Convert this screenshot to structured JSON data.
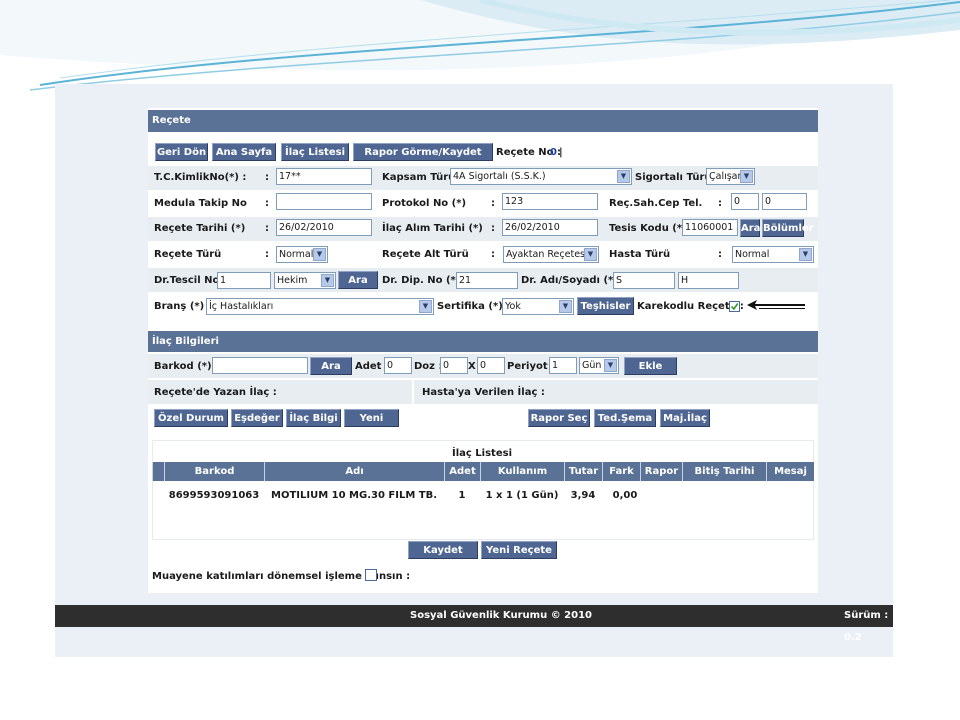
{
  "colors": {
    "header_bar": "#5a7296",
    "button": "#4e6691",
    "footer": "#2e2e2e",
    "row_alt": "#e8edf2",
    "frame": "#eaf0f6"
  },
  "recete": {
    "title": "Reçete",
    "buttons": {
      "geri_don": "Geri Dön",
      "ana_sayfa": "Ana Sayfa",
      "ilac_listesi": "İlaç Listesi",
      "rapor_gorme": "Rapor Görme/Kaydet"
    },
    "recete_no_label": "Reçete No :",
    "recete_no_value": "0",
    "recete_no_sep": "|",
    "tc_label": "T.C.KimlikNo(*) :",
    "tc_value": "17**",
    "kapsam_label": "Kapsam Türü :",
    "kapsam_value": "4A Sigortalı (S.S.K.)",
    "sigortali_label": "Sigortalı Türü :",
    "sigortali_value": "Çalışan",
    "medula_label": "Medula Takip No",
    "medula_value": "",
    "protokol_label": "Protokol No (*)",
    "protokol_value": "123",
    "cep_label": "Reç.Sah.Cep Tel.",
    "cep_value1": "0",
    "cep_value2": "0",
    "tarih_label": "Reçete Tarihi (*)",
    "tarih_value": "26/02/2010",
    "alim_label": "İlaç Alım Tarihi (*)",
    "alim_value": "26/02/2010",
    "tesis_label": "Tesis Kodu (*) :",
    "tesis_value": "11060001",
    "ara": "Ara",
    "bolumler": "Bölümler",
    "turu_label": "Reçete Türü",
    "turu_value": "Normal",
    "alt_label": "Reçete Alt Türü",
    "alt_value": "Ayaktan Reçetesi",
    "hasta_label": "Hasta Türü",
    "hasta_value": "Normal",
    "tescil_label": "Dr.Tescil No :",
    "tescil_value": "1",
    "hekim_value": "Hekim",
    "dip_label": "Dr. Dip. No (*) :",
    "dip_value": "21",
    "adi_label": "Dr. Adı/Soyadı (*) :",
    "adi_value1": "S",
    "adi_value2": "H",
    "brans_label": "Branş (*) :",
    "brans_value": "İç Hastalıkları",
    "sertifika_label": "Sertifika (*) :",
    "sertifika_value": "Yok",
    "teshisler": "Teşhisler",
    "karekod_label": "Karekodlu Reçete :",
    "colon": ":"
  },
  "ilac": {
    "title": "İlaç Bilgileri",
    "barkod_label": "Barkod (*) :",
    "barkod_value": "",
    "ara": "Ara",
    "adet_label": "Adet :",
    "adet_value": "0",
    "doz_label": "Doz :",
    "doz_value1": "0",
    "doz_x": "X",
    "doz_value2": "0",
    "periyot_label": "Periyot :",
    "periyot_value": "1",
    "periyot_unit": "Gün",
    "ekle": "Ekle",
    "yazan_label": "Reçete'de Yazan İlaç :",
    "verilen_label": "Hasta'ya Verilen İlaç :",
    "buttons": {
      "ozel_durum": "Özel Durum",
      "esdeger": "Eşdeğer",
      "ilac_bilgi": "İlaç Bilgi",
      "yeni": "Yeni",
      "rapor_sec": "Rapor Seç",
      "ted_sema": "Ted.Şema",
      "maj_ilac": "Maj.İlaç"
    }
  },
  "liste": {
    "title": "İlaç Listesi",
    "columns": [
      "Barkod",
      "Adı",
      "Adet",
      "Kullanım",
      "Tutar",
      "Fark",
      "Rapor",
      "Bitiş Tarihi",
      "Mesaj"
    ],
    "rows": [
      [
        "8699593091063",
        "MOTILIUM 10 MG.30 FILM TB.",
        "1",
        "1 x 1 (1 Gün)",
        "3,94",
        "0,00",
        "",
        "",
        ""
      ]
    ]
  },
  "actions": {
    "kaydet": "Kaydet",
    "yeni_recete": "Yeni Reçete"
  },
  "muayene_label": "Muayene katılımları dönemsel işleme alınsın :",
  "footer": {
    "copyright": "Sosyal Güvenlik Kurumu © 2010",
    "version": "Sürüm : 0.2"
  }
}
